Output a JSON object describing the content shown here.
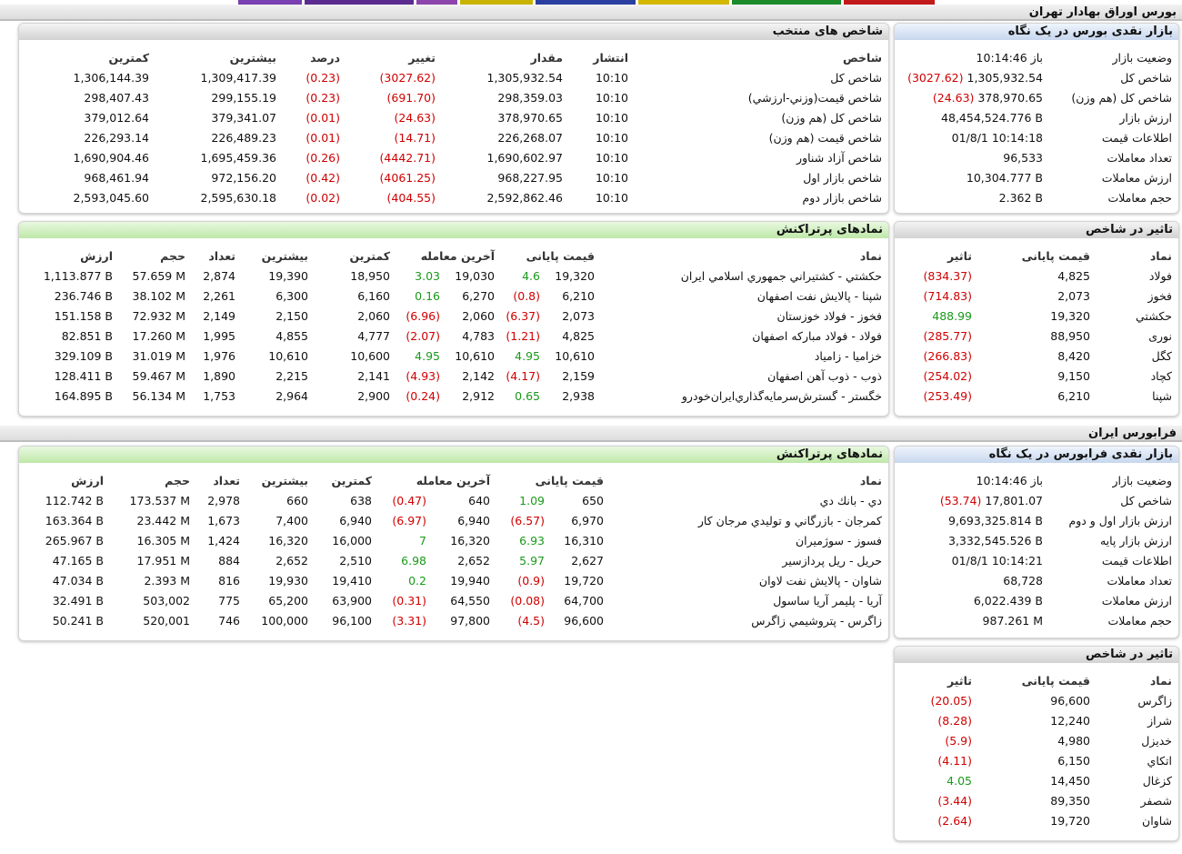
{
  "colors": {
    "negative": "#d00000",
    "positive": "#1a9a1a"
  },
  "tse": {
    "title": "بورس اوراق بهادار تهران",
    "glance": {
      "title": "بازار نقدی بورس در یک نگاه",
      "rows": [
        {
          "label": "وضعیت بازار",
          "value": "باز 10:14:46",
          "change": ""
        },
        {
          "label": "شاخص کل",
          "value": "1,305,932.54",
          "change": "(3027.62)"
        },
        {
          "label": "شاخص کل (هم وزن)",
          "value": "378,970.65",
          "change": "(24.63)"
        },
        {
          "label": "ارزش بازار",
          "value": "48,454,524.776 B",
          "change": ""
        },
        {
          "label": "اطلاعات قیمت",
          "value": "01/8/1 10:14:18",
          "change": ""
        },
        {
          "label": "تعداد معاملات",
          "value": "96,533",
          "change": ""
        },
        {
          "label": "ارزش معاملات",
          "value": "10,304.777 B",
          "change": ""
        },
        {
          "label": "حجم معاملات",
          "value": "2.362 B",
          "change": ""
        }
      ]
    },
    "indices": {
      "title": "شاخص های منتخب",
      "headers": {
        "name": "شاخص",
        "time": "انتشار",
        "value": "مقدار",
        "change": "تغییر",
        "pct": "درصد",
        "high": "بیشترین",
        "low": "کمترین"
      },
      "rows": [
        {
          "name": "شاخص كل",
          "time": "10:10",
          "value": "1,305,932.54",
          "change": "(3027.62)",
          "pct": "(0.23)",
          "high": "1,309,417.39",
          "low": "1,306,144.39"
        },
        {
          "name": "شاخص قيمت(وزني-ارزشي)",
          "time": "10:10",
          "value": "298,359.03",
          "change": "(691.70)",
          "pct": "(0.23)",
          "high": "299,155.19",
          "low": "298,407.43"
        },
        {
          "name": "شاخص كل (هم وزن)",
          "time": "10:10",
          "value": "378,970.65",
          "change": "(24.63)",
          "pct": "(0.01)",
          "high": "379,341.07",
          "low": "379,012.64"
        },
        {
          "name": "شاخص قيمت (هم وزن)",
          "time": "10:10",
          "value": "226,268.07",
          "change": "(14.71)",
          "pct": "(0.01)",
          "high": "226,489.23",
          "low": "226,293.14"
        },
        {
          "name": "شاخص آزاد شناور",
          "time": "10:10",
          "value": "1,690,602.97",
          "change": "(4442.71)",
          "pct": "(0.26)",
          "high": "1,695,459.36",
          "low": "1,690,904.46"
        },
        {
          "name": "شاخص بازار اول",
          "time": "10:10",
          "value": "968,227.95",
          "change": "(4061.25)",
          "pct": "(0.42)",
          "high": "972,156.20",
          "low": "968,461.94"
        },
        {
          "name": "شاخص بازار دوم",
          "time": "10:10",
          "value": "2,592,862.46",
          "change": "(404.55)",
          "pct": "(0.02)",
          "high": "2,595,630.18",
          "low": "2,593,045.60"
        }
      ]
    },
    "impact": {
      "title": "تاثیر در شاخص",
      "headers": {
        "symbol": "نماد",
        "price": "قیمت پایانی",
        "impact": "تاثیر"
      },
      "rows": [
        {
          "symbol": "فولاد",
          "price": "4,825",
          "impact": "(834.37)"
        },
        {
          "symbol": "فخوز",
          "price": "2,073",
          "impact": "(714.83)"
        },
        {
          "symbol": "حكشتي",
          "price": "19,320",
          "impact": "488.99"
        },
        {
          "symbol": "نوری",
          "price": "88,950",
          "impact": "(285.77)"
        },
        {
          "symbol": "كگل",
          "price": "8,420",
          "impact": "(266.83)"
        },
        {
          "symbol": "كچاد",
          "price": "9,150",
          "impact": "(254.02)"
        },
        {
          "symbol": "شپنا",
          "price": "6,210",
          "impact": "(253.49)"
        }
      ]
    },
    "active": {
      "title": "نمادهای پرتراکنش",
      "headers": {
        "symbol": "نماد",
        "final": "قیمت پایانی",
        "last": "آخرین معامله",
        "low": "کمترین",
        "high": "بیشترین",
        "count": "تعداد",
        "volume": "حجم",
        "value": "ارزش"
      },
      "rows": [
        {
          "symbol": "حكشتي - كشتيراني جمهوري اسلامي ايران",
          "final": "19,320",
          "final_ch": "4.6",
          "last": "19,030",
          "last_ch": "3.03",
          "low": "18,950",
          "high": "19,390",
          "count": "2,874",
          "volume": "57.659 M",
          "value": "1,113.877 B"
        },
        {
          "symbol": "شپنا - پالايش نفت اصفهان",
          "final": "6,210",
          "final_ch": "(0.8)",
          "last": "6,270",
          "last_ch": "0.16",
          "low": "6,160",
          "high": "6,300",
          "count": "2,261",
          "volume": "38.102 M",
          "value": "236.746 B"
        },
        {
          "symbol": "فخوز - فولاد خوزستان",
          "final": "2,073",
          "final_ch": "(6.37)",
          "last": "2,060",
          "last_ch": "(6.96)",
          "low": "2,060",
          "high": "2,150",
          "count": "2,149",
          "volume": "72.932 M",
          "value": "151.158 B"
        },
        {
          "symbol": "فولاد - فولاد مباركه اصفهان",
          "final": "4,825",
          "final_ch": "(1.21)",
          "last": "4,783",
          "last_ch": "(2.07)",
          "low": "4,777",
          "high": "4,855",
          "count": "1,995",
          "volume": "17.260 M",
          "value": "82.851 B"
        },
        {
          "symbol": "خزاميا - زامياد",
          "final": "10,610",
          "final_ch": "4.95",
          "last": "10,610",
          "last_ch": "4.95",
          "low": "10,600",
          "high": "10,610",
          "count": "1,976",
          "volume": "31.019 M",
          "value": "329.109 B"
        },
        {
          "symbol": "ذوب - ذوب آهن اصفهان",
          "final": "2,159",
          "final_ch": "(4.17)",
          "last": "2,142",
          "last_ch": "(4.93)",
          "low": "2,141",
          "high": "2,215",
          "count": "1,890",
          "volume": "59.467 M",
          "value": "128.411 B"
        },
        {
          "symbol": "خگستر - گسترش‌سرمايه‌گذاري‌ايران‌خودرو",
          "final": "2,938",
          "final_ch": "0.65",
          "last": "2,912",
          "last_ch": "(0.24)",
          "low": "2,900",
          "high": "2,964",
          "count": "1,753",
          "volume": "56.134 M",
          "value": "164.895 B"
        }
      ]
    }
  },
  "ifb": {
    "title": "فرابورس ایران",
    "glance": {
      "title": "بازار نقدی فرابورس در یک نگاه",
      "rows": [
        {
          "label": "وضعیت بازار",
          "value": "باز 10:14:46",
          "change": ""
        },
        {
          "label": "شاخص کل",
          "value": "17,801.07",
          "change": "(53.74)"
        },
        {
          "label": "ارزش بازار اول و دوم",
          "value": "9,693,325.814 B",
          "change": ""
        },
        {
          "label": "ارزش بازار پایه",
          "value": "3,332,545.526 B",
          "change": ""
        },
        {
          "label": "اطلاعات قیمت",
          "value": "01/8/1 10:14:21",
          "change": ""
        },
        {
          "label": "تعداد معاملات",
          "value": "68,728",
          "change": ""
        },
        {
          "label": "ارزش معاملات",
          "value": "6,022.439 B",
          "change": ""
        },
        {
          "label": "حجم معاملات",
          "value": "987.261 M",
          "change": ""
        }
      ]
    },
    "active": {
      "title": "نمادهای پرتراکنش",
      "headers": {
        "symbol": "نماد",
        "final": "قیمت پایانی",
        "last": "آخرین معامله",
        "low": "کمترین",
        "high": "بیشترین",
        "count": "تعداد",
        "volume": "حجم",
        "value": "ارزش"
      },
      "rows": [
        {
          "symbol": "دي - بانك دي",
          "final": "650",
          "final_ch": "1.09",
          "last": "640",
          "last_ch": "(0.47)",
          "low": "638",
          "high": "660",
          "count": "2,978",
          "volume": "173.537 M",
          "value": "112.742 B"
        },
        {
          "symbol": "كمرجان - بازرگاني و توليدي مرجان كار",
          "final": "6,970",
          "final_ch": "(6.57)",
          "last": "6,940",
          "last_ch": "(6.97)",
          "low": "6,940",
          "high": "7,400",
          "count": "1,673",
          "volume": "23.442 M",
          "value": "163.364 B"
        },
        {
          "symbol": "فسوز - سوژميران",
          "final": "16,310",
          "final_ch": "6.93",
          "last": "16,320",
          "last_ch": "7",
          "low": "16,000",
          "high": "16,320",
          "count": "1,424",
          "volume": "16.305 M",
          "value": "265.967 B"
        },
        {
          "symbol": "حريل - ريل پردازسير",
          "final": "2,627",
          "final_ch": "5.97",
          "last": "2,652",
          "last_ch": "6.98",
          "low": "2,510",
          "high": "2,652",
          "count": "884",
          "volume": "17.951 M",
          "value": "47.165 B"
        },
        {
          "symbol": "شاوان - پالايش نفت لاوان",
          "final": "19,720",
          "final_ch": "(0.9)",
          "last": "19,940",
          "last_ch": "0.2",
          "low": "19,410",
          "high": "19,930",
          "count": "816",
          "volume": "2.393 M",
          "value": "47.034 B"
        },
        {
          "symbol": "آريا - پليمر آريا ساسول",
          "final": "64,700",
          "final_ch": "(0.08)",
          "last": "64,550",
          "last_ch": "(0.31)",
          "low": "63,900",
          "high": "65,200",
          "count": "775",
          "volume": "503,002",
          "value": "32.491 B"
        },
        {
          "symbol": "زاگرس - پتروشيمي زاگرس",
          "final": "96,600",
          "final_ch": "(4.5)",
          "last": "97,800",
          "last_ch": "(3.31)",
          "low": "96,100",
          "high": "100,000",
          "count": "746",
          "volume": "520,001",
          "value": "50.241 B"
        }
      ]
    },
    "impact": {
      "title": "تاثیر در شاخص",
      "headers": {
        "symbol": "نماد",
        "price": "قیمت پایانی",
        "impact": "تاثیر"
      },
      "rows": [
        {
          "symbol": "زاگرس",
          "price": "96,600",
          "impact": "(20.05)"
        },
        {
          "symbol": "شراز",
          "price": "12,240",
          "impact": "(8.28)"
        },
        {
          "symbol": "خديزل",
          "price": "4,980",
          "impact": "(5.9)"
        },
        {
          "symbol": "اتكاي",
          "price": "6,150",
          "impact": "(4.11)"
        },
        {
          "symbol": "كزغال",
          "price": "14,450",
          "impact": "4.05"
        },
        {
          "symbol": "شصفر",
          "price": "89,350",
          "impact": "(3.44)"
        },
        {
          "symbol": "شاوان",
          "price": "19,720",
          "impact": "(2.64)"
        }
      ]
    }
  }
}
